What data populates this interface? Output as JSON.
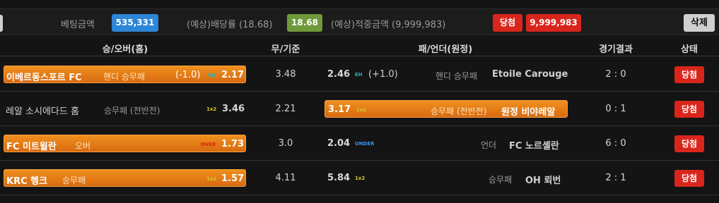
{
  "summary": {
    "bet_amount_label": "베팅금액",
    "bet_amount": "535,331",
    "odds_label": "(예상)배당률 (18.68)",
    "odds_value": "18.68",
    "payout_label": "(예상)적중금액 (9,999,983)",
    "result_badge": "당첨",
    "payout_value": "9,999,983",
    "delete_label": "삭제"
  },
  "headers": {
    "home": "승/오버(홈)",
    "draw": "무/기준",
    "away": "패/언더(원정)",
    "result": "경기결과",
    "status": "상태"
  },
  "rows": [
    {
      "home_team": "이베르동스포르 FC",
      "home_type": "핸디 승무패",
      "home_handi": "(-1.0)",
      "home_icon": "EH",
      "home_odds": "2.17",
      "draw_value": "3.48",
      "away_odds": "2.46",
      "away_icon": "EH",
      "away_handi": "(+1.0)",
      "away_type": "핸디 승무패",
      "away_team": "Etoile Carouge",
      "score": "2 : 0",
      "status": "당첨"
    },
    {
      "home_team": "레알 소시에다드 홈",
      "home_type": "승무패 (전반전)",
      "home_icon": "1x2",
      "home_odds": "3.46",
      "draw_value": "2.21",
      "away_odds": "3.17",
      "away_icon": "1x2",
      "away_type": "승무패 (전반전)",
      "away_team": "원정 비야레알",
      "score": "0 : 1",
      "status": "당첨"
    },
    {
      "home_team": "FC 미트윌란",
      "home_type": "오버",
      "home_icon": "OVER",
      "home_odds": "1.73",
      "draw_value": "3.0",
      "away_odds": "2.04",
      "away_icon": "UNDER",
      "away_type": "언더",
      "away_team": "FC 노르셸란",
      "score": "6 : 0",
      "status": "당첨"
    },
    {
      "home_team": "KRC 헹크",
      "home_type": "승무패",
      "home_icon": "1x2",
      "home_odds": "1.57",
      "draw_value": "4.11",
      "away_odds": "5.84",
      "away_icon": "1x2",
      "away_type": "승무패",
      "away_team": "OH 뢰번",
      "score": "2 : 1",
      "status": "당첨"
    }
  ],
  "colors": {
    "selected": "#e8801a",
    "badge_red": "#d9261c",
    "bet_blue": "#2e86d8",
    "odds_green": "#6f9a3a"
  }
}
